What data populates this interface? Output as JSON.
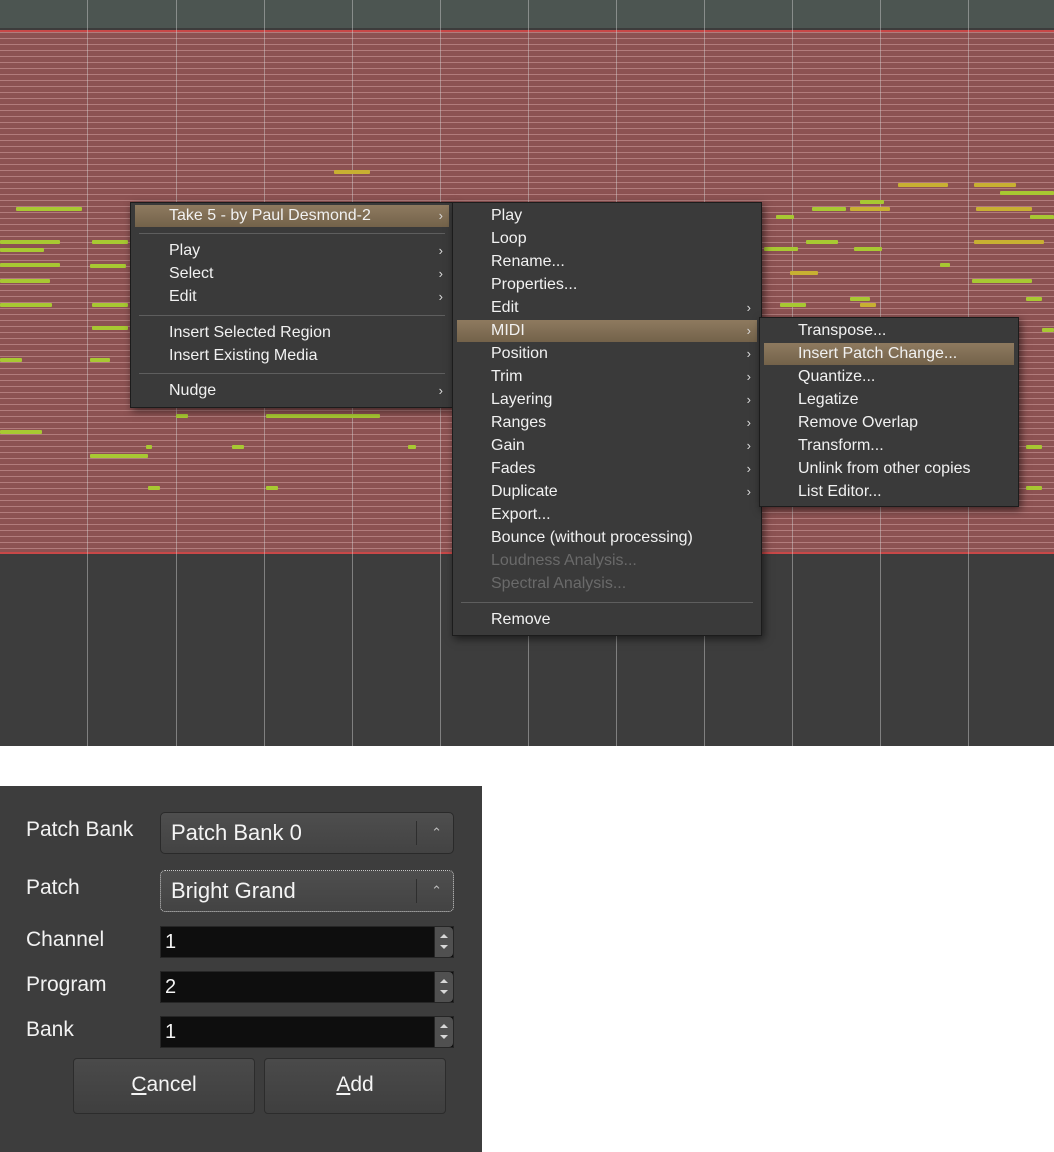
{
  "context_menu": {
    "header": "Take 5 - by Paul Desmond-2",
    "items": [
      "Play",
      "Select",
      "Edit"
    ],
    "insert_items": [
      "Insert Selected Region",
      "Insert Existing Media"
    ],
    "nudge": "Nudge"
  },
  "region_menu": {
    "items": [
      "Play",
      "Loop",
      "Rename...",
      "Properties...",
      "Edit",
      "MIDI",
      "Position",
      "Trim",
      "Layering",
      "Ranges",
      "Gain",
      "Fades",
      "Duplicate",
      "Export...",
      "Bounce (without processing)",
      "Loudness Analysis...",
      "Spectral Analysis..."
    ],
    "remove": "Remove"
  },
  "midi_menu": {
    "items": [
      "Transpose...",
      "Insert Patch Change...",
      "Quantize...",
      "Legatize",
      "Remove Overlap",
      "Transform...",
      "Unlink from other copies",
      "List Editor..."
    ]
  },
  "dialog": {
    "patch_bank_label": "Patch Bank",
    "patch_bank_value": "Patch Bank 0",
    "patch_label": "Patch",
    "patch_value": "Bright Grand",
    "channel_label": "Channel",
    "channel_value": "1",
    "program_label": "Program",
    "program_value": "2",
    "bank_label": "Bank",
    "bank_value": "1",
    "cancel_mnemonic": "C",
    "cancel_rest": "ancel",
    "add_mnemonic": "A",
    "add_rest": "dd"
  },
  "colors": {
    "region": "#8c5252",
    "region_border": "#c84848",
    "note_green": "#a8c832",
    "note_yellow": "#c8b032",
    "menu_bg": "#3a3a3a",
    "menu_highlight": "#8e7a5f",
    "dialog_bg": "#3d3d3d"
  }
}
